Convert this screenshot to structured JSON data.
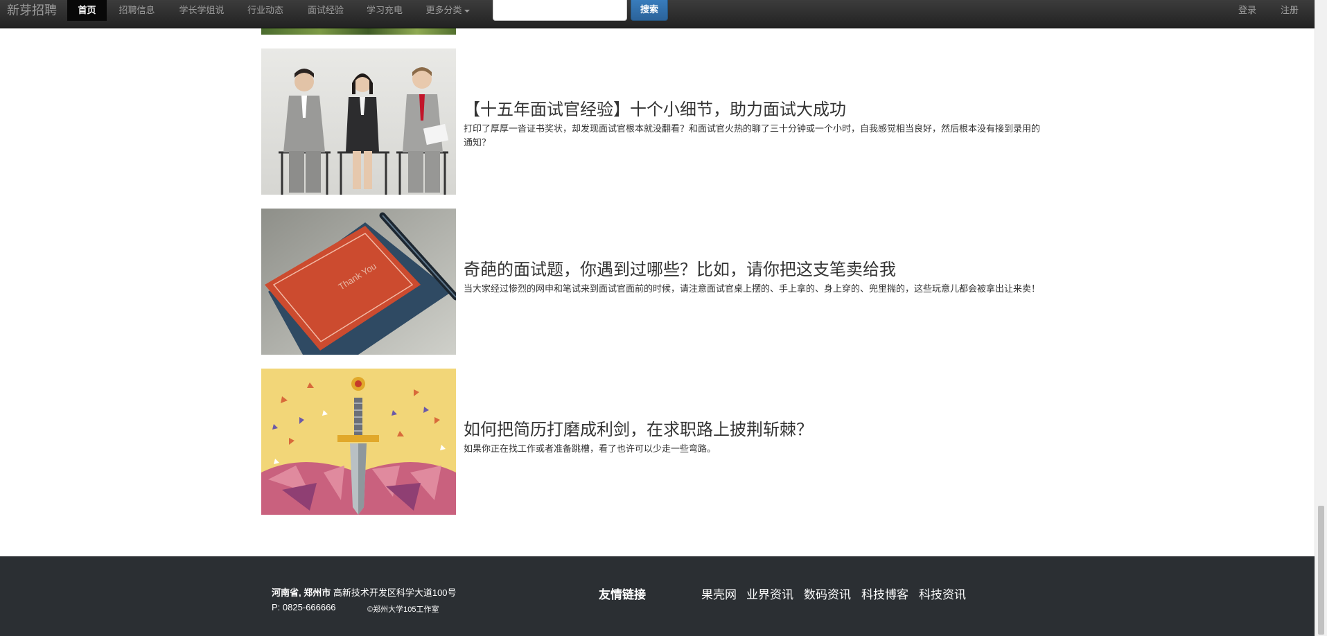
{
  "navbar": {
    "brand": "新芽招聘",
    "items": [
      {
        "label": "首页",
        "active": true
      },
      {
        "label": "招聘信息"
      },
      {
        "label": "学长学姐说"
      },
      {
        "label": "行业动态"
      },
      {
        "label": "面试经验"
      },
      {
        "label": "学习充电"
      },
      {
        "label": "更多分类"
      }
    ],
    "search": {
      "value": "",
      "button_label": "搜索"
    },
    "login_label": "登录",
    "register_label": "注册"
  },
  "articles": [
    {
      "title": "【十五年面试官经验】十个小细节，助力面试大成功",
      "summary": "打印了厚厚一沓证书奖状，却发现面试官根本就没翻看？和面试官火热的聊了三十分钟或一个小时，自我感觉相当良好，然后根本没有接到录用的通知？",
      "image": "interview-candidates-image"
    },
    {
      "title": "奇葩的面试题，你遇到过哪些？比如，请你把这支笔卖给我",
      "summary": "当大家经过惨烈的网申和笔试来到面试官面前的时候，请注意面试官桌上摆的、手上拿的、身上穿的、兜里揣的，这些玩意儿都会被拿出让来卖！",
      "image": "thank-you-card-image",
      "card_text": "Thank You"
    },
    {
      "title": "如何把简历打磨成利剑，在求职路上披荆斩棘？",
      "summary": "如果你正在找工作或者准备跳槽，看了也许可以少走一些弯路。",
      "image": "sword-illustration-image"
    }
  ],
  "footer": {
    "address_prefix": "河南省, 郑州市",
    "address_rest": " 高新技术开发区科学大道100号",
    "phone": "P: 0825-666666",
    "copyright": "©郑州大学105工作室",
    "links_label": "友情链接",
    "links": [
      "果壳网",
      "业界资讯",
      "数码资讯",
      "科技博客",
      "科技资讯"
    ]
  },
  "colors": {
    "navbar_bg": "#222222",
    "footer_bg": "#2b2f33",
    "search_button": "#2b639a",
    "text": "#333333"
  }
}
